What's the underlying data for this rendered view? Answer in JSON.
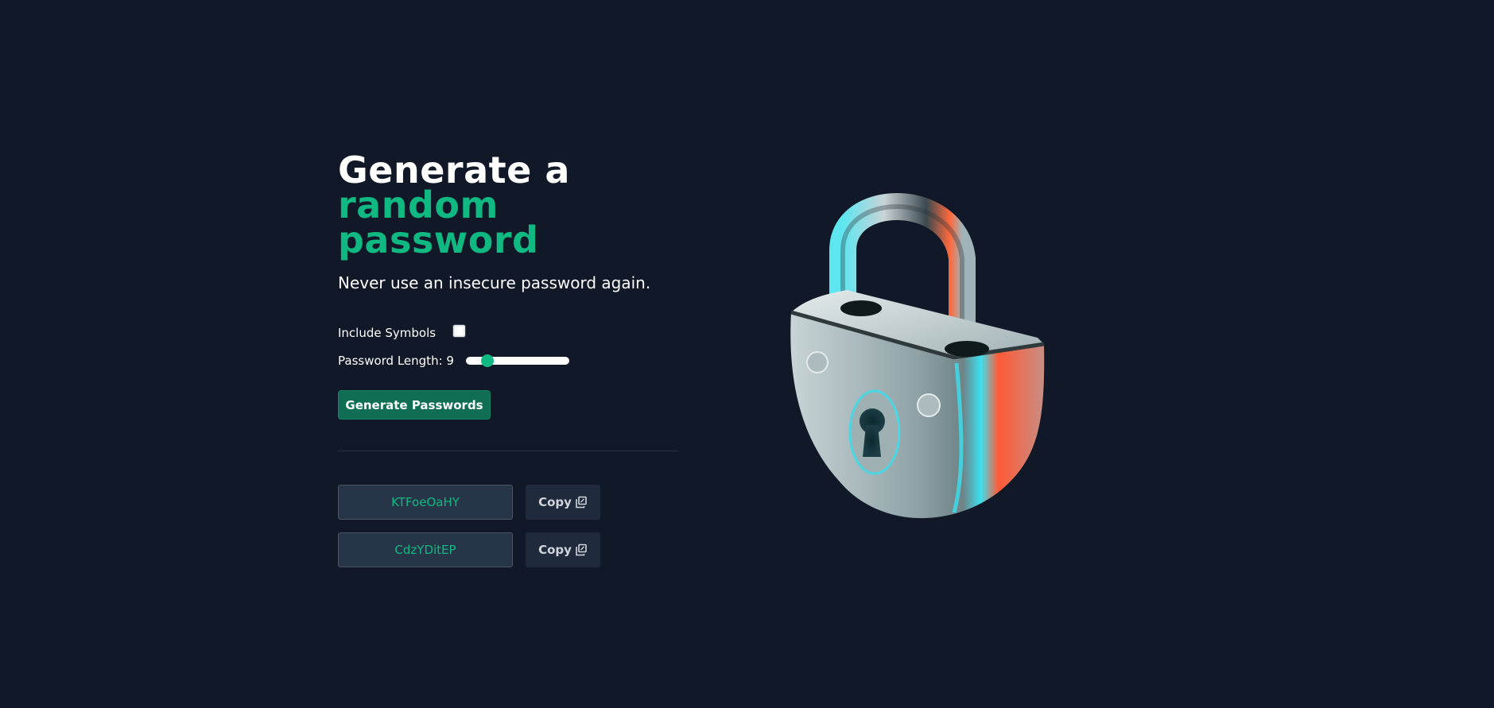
{
  "hero": {
    "title_line1": "Generate a",
    "title_line2": "random password",
    "subtitle": "Never use an insecure password again."
  },
  "options": {
    "symbols_label": "Include Symbols",
    "symbols_checked": false,
    "length_label": "Password Length: 9",
    "length_value": 9
  },
  "actions": {
    "generate_label": "Generate Passwords"
  },
  "passwords": [
    {
      "value": "KTFoeOaHY",
      "copy_label": "Copy"
    },
    {
      "value": "CdzYDitEP",
      "copy_label": "Copy"
    }
  ],
  "icons": {
    "copy": "copy-icon",
    "illustration": "padlock-illustration"
  },
  "colors": {
    "background": "#111827",
    "accent": "#10b981",
    "button": "#0f6e53"
  }
}
